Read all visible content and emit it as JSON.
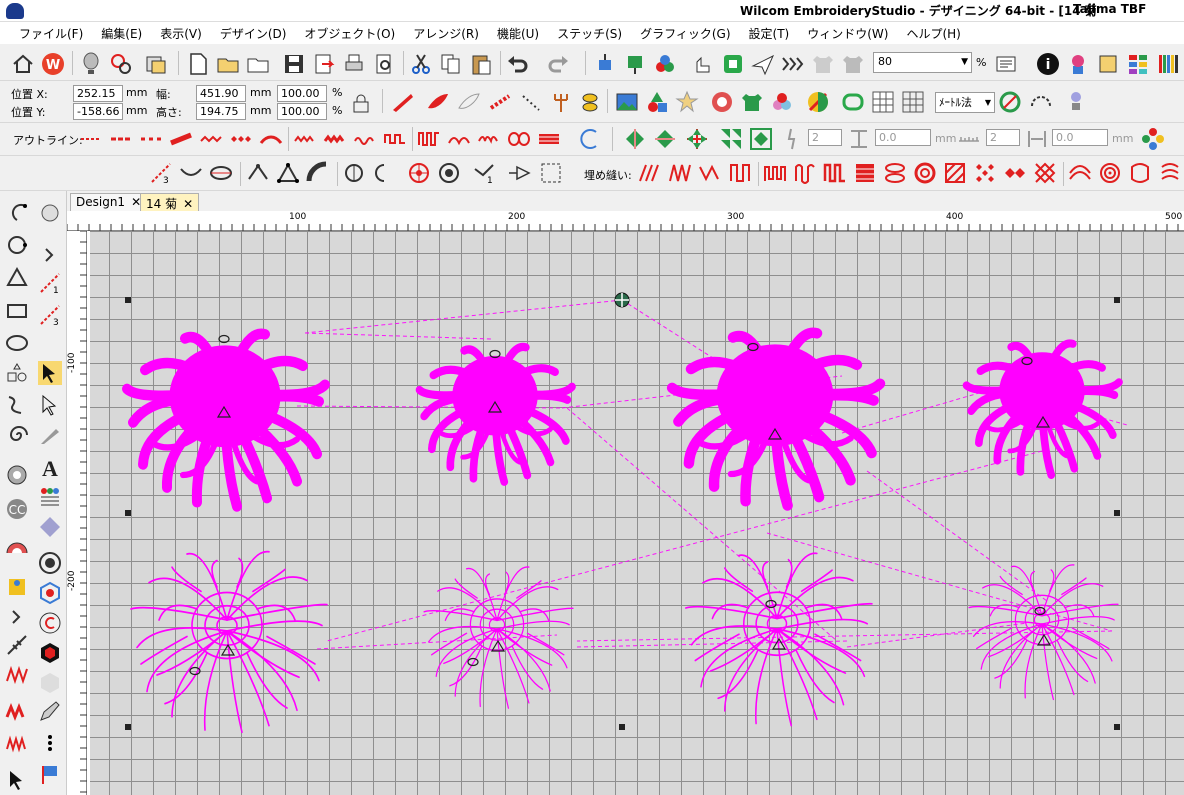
{
  "window": {
    "title": "Wilcom EmbroideryStudio - デザイニング 64-bit - [14 菊",
    "machine": "Tajima TBF"
  },
  "menu": [
    "ファイル(F)",
    "編集(E)",
    "表示(V)",
    "デザイン(D)",
    "オブジェクト(O)",
    "アレンジ(R)",
    "機能(U)",
    "ステッチ(S)",
    "グラフィック(G)",
    "設定(T)",
    "ウィンドウ(W)",
    "ヘルプ(H)"
  ],
  "toolbar": {
    "zoom_value": "80",
    "zoom_unit": "%"
  },
  "properties": {
    "pos_x_label": "位置 X:",
    "pos_x": "252.15",
    "pos_y_label": "位置 Y:",
    "pos_y": "-158.66",
    "width_label": "幅:",
    "width": "451.90",
    "height_label": "高さ:",
    "height": "194.75",
    "unit": "mm",
    "scale_w": "100.00",
    "scale_h": "100.00",
    "pct": "%",
    "method": "ﾒｰﾄﾙ法"
  },
  "outline": {
    "label": "アウトライン:",
    "spin1": "2",
    "spin2": "0.0",
    "spin3": "2",
    "spin4": "0.0",
    "unit": "mm"
  },
  "fill": {
    "label": "埋め縫い:"
  },
  "tabs": [
    {
      "label": "Design1"
    },
    {
      "label": "14 菊"
    }
  ],
  "ruler": {
    "h_ticks": [
      "100",
      "200",
      "300",
      "400",
      "500"
    ],
    "v_ticks": [
      "-100",
      "-200"
    ]
  },
  "colors": {
    "stitch": "#ff00ff",
    "grid": "#d8d8d8",
    "accent_red": "#e02020"
  }
}
